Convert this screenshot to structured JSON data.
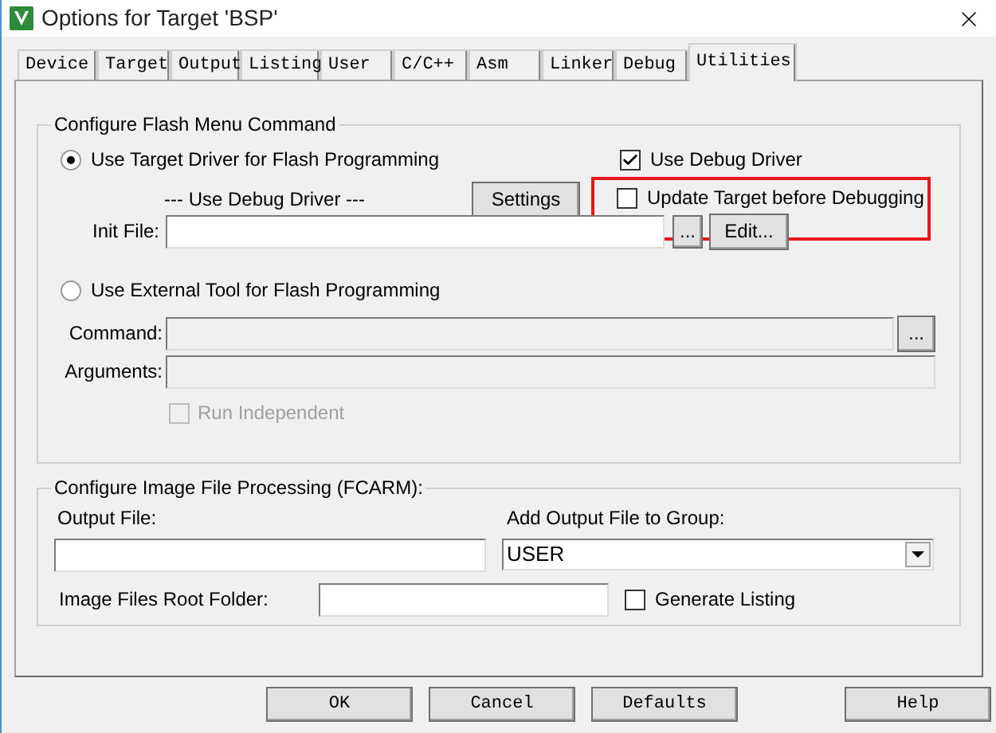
{
  "window": {
    "title": "Options for Target 'BSP'"
  },
  "tabs": [
    {
      "label": "Device",
      "selected": false
    },
    {
      "label": "Target",
      "selected": false
    },
    {
      "label": "Output",
      "selected": false
    },
    {
      "label": "Listing",
      "selected": false
    },
    {
      "label": "User",
      "selected": false
    },
    {
      "label": "C/C++",
      "selected": false
    },
    {
      "label": "Asm",
      "selected": false
    },
    {
      "label": "Linker",
      "selected": false
    },
    {
      "label": "Debug",
      "selected": false
    },
    {
      "label": "Utilities",
      "selected": true
    }
  ],
  "flash_group": {
    "title": "Configure Flash Menu Command",
    "target_driver": {
      "label": "Use Target Driver for Flash Programming",
      "selected": true
    },
    "use_debug_driver": {
      "label": "Use Debug Driver",
      "checked": true
    },
    "driver_text": "--- Use Debug Driver ---",
    "settings_button": "Settings",
    "update_target": {
      "label": "Update Target before Debugging",
      "checked": false,
      "highlighted": true
    },
    "init_file": {
      "label": "Init File:",
      "browse_button": "...",
      "edit_button": "Edit..."
    },
    "external_tool": {
      "label": "Use External Tool for Flash Programming",
      "selected": false
    },
    "command": {
      "label": "Command:",
      "browse_button": "...",
      "disabled": true
    },
    "arguments": {
      "label": "Arguments:",
      "disabled": true
    },
    "run_independent": {
      "label": "Run Independent",
      "checked": false,
      "disabled": true
    }
  },
  "image_group": {
    "title": "Configure Image File Processing (FCARM):",
    "output_file": {
      "label": "Output File:"
    },
    "add_to_group": {
      "label": "Add Output File  to Group:",
      "value": "USER"
    },
    "root_folder": {
      "label": "Image Files Root Folder:"
    },
    "generate_listing": {
      "label": "Generate Listing",
      "checked": false
    }
  },
  "buttons": [
    "OK",
    "Cancel",
    "Defaults",
    "Help"
  ]
}
